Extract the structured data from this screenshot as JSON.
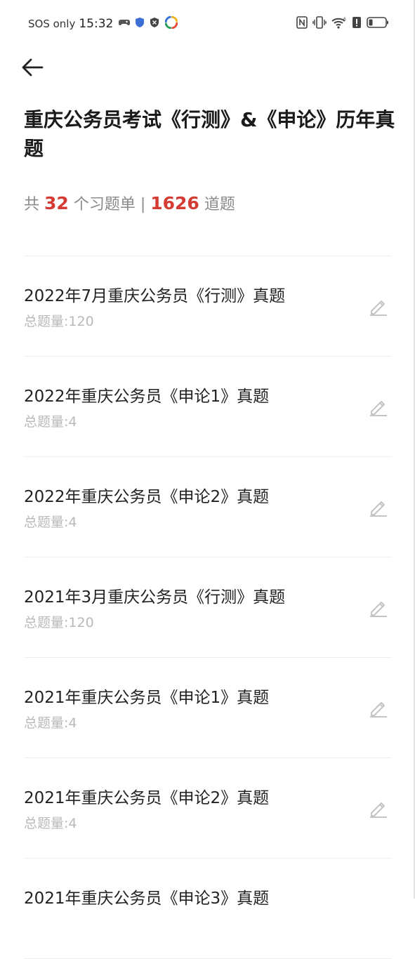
{
  "status_bar": {
    "carrier": "SOS only",
    "time": "15:32"
  },
  "header": {
    "title": "重庆公务员考试《行测》&《申论》历年真题"
  },
  "summary": {
    "prefix": "共",
    "sheet_count": "32",
    "sheet_unit": "个习题单",
    "separator": "|",
    "question_count": "1626",
    "question_unit": "道题"
  },
  "items": [
    {
      "title": "2022年7月重庆公务员《行测》真题",
      "count": "总题量:120"
    },
    {
      "title": "2022年重庆公务员《申论1》真题",
      "count": "总题量:4"
    },
    {
      "title": "2022年重庆公务员《申论2》真题",
      "count": "总题量:4"
    },
    {
      "title": "2021年3月重庆公务员《行测》真题",
      "count": "总题量:120"
    },
    {
      "title": "2021年重庆公务员《申论1》真题",
      "count": "总题量:4"
    },
    {
      "title": "2021年重庆公务员《申论2》真题",
      "count": "总题量:4"
    },
    {
      "title": "2021年重庆公务员《申论3》真题",
      "count": ""
    }
  ]
}
